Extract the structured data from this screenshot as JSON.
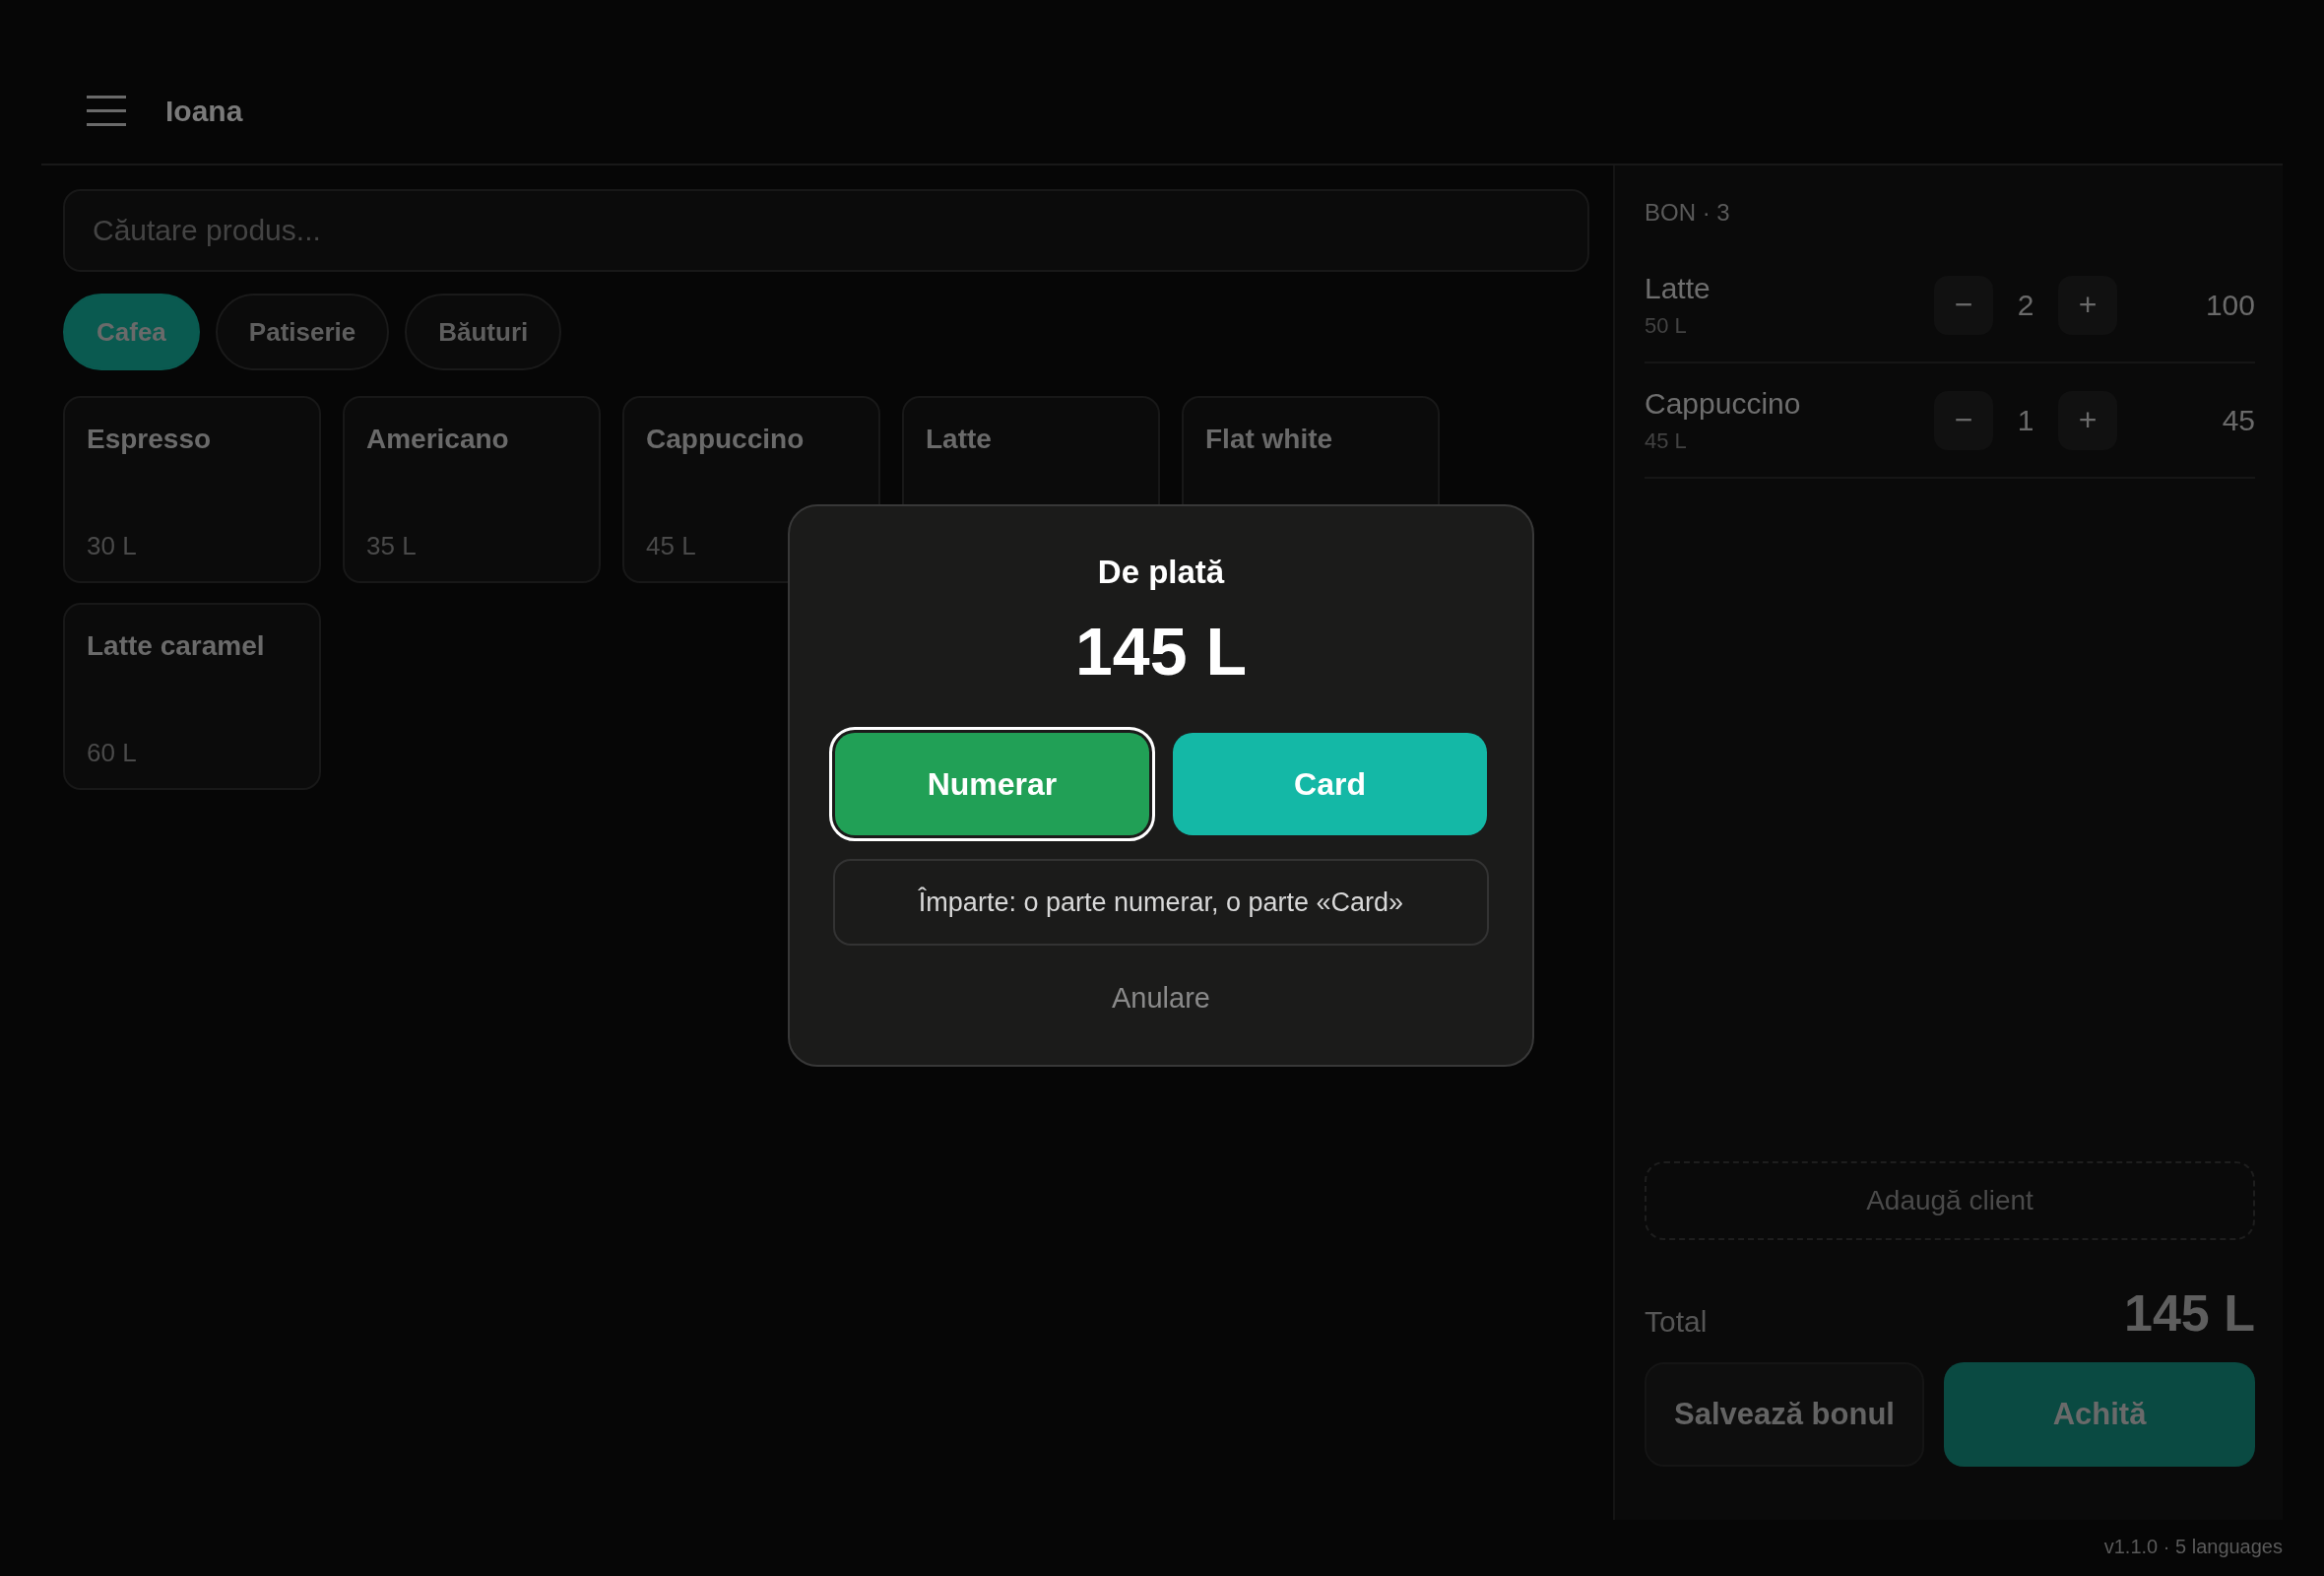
{
  "header": {
    "user": "Ioana"
  },
  "search": {
    "placeholder": "Căutare produs..."
  },
  "categories": [
    {
      "label": "Cafea",
      "selected": true
    },
    {
      "label": "Patiserie",
      "selected": false
    },
    {
      "label": "Băuturi",
      "selected": false
    }
  ],
  "products": [
    {
      "name": "Espresso",
      "price": "30 L"
    },
    {
      "name": "Americano",
      "price": "35 L"
    },
    {
      "name": "Cappuccino",
      "price": "45 L"
    },
    {
      "name": "Latte"
    },
    {
      "name": "Flat white"
    },
    {
      "name": "Latte caramel",
      "price": "60 L"
    }
  ],
  "receipt": {
    "title": "BON · 3",
    "items": [
      {
        "name": "Latte",
        "unit_price": "50 L",
        "decrement": "−",
        "quantity": "2",
        "increment": "+",
        "line_total": "100"
      },
      {
        "name": "Cappuccino",
        "unit_price": "45 L",
        "decrement": "−",
        "quantity": "1",
        "increment": "+",
        "line_total": "45"
      }
    ],
    "add_client": "Adaugă client",
    "total_label": "Total",
    "total": "145 L",
    "save_button": "Salvează bonul",
    "pay_button": "Achită"
  },
  "payment_dialog": {
    "title": "De plată",
    "amount": "145 L",
    "methods": [
      {
        "label": "Numerar",
        "selected": true,
        "color": "#21a056"
      },
      {
        "label": "Card",
        "selected": false,
        "color": "#14b8a6"
      }
    ],
    "split": "Împarte: o parte numerar, o parte «Card»",
    "cancel": "Anulare"
  },
  "footer": "v1.1.0 · 5 languages"
}
